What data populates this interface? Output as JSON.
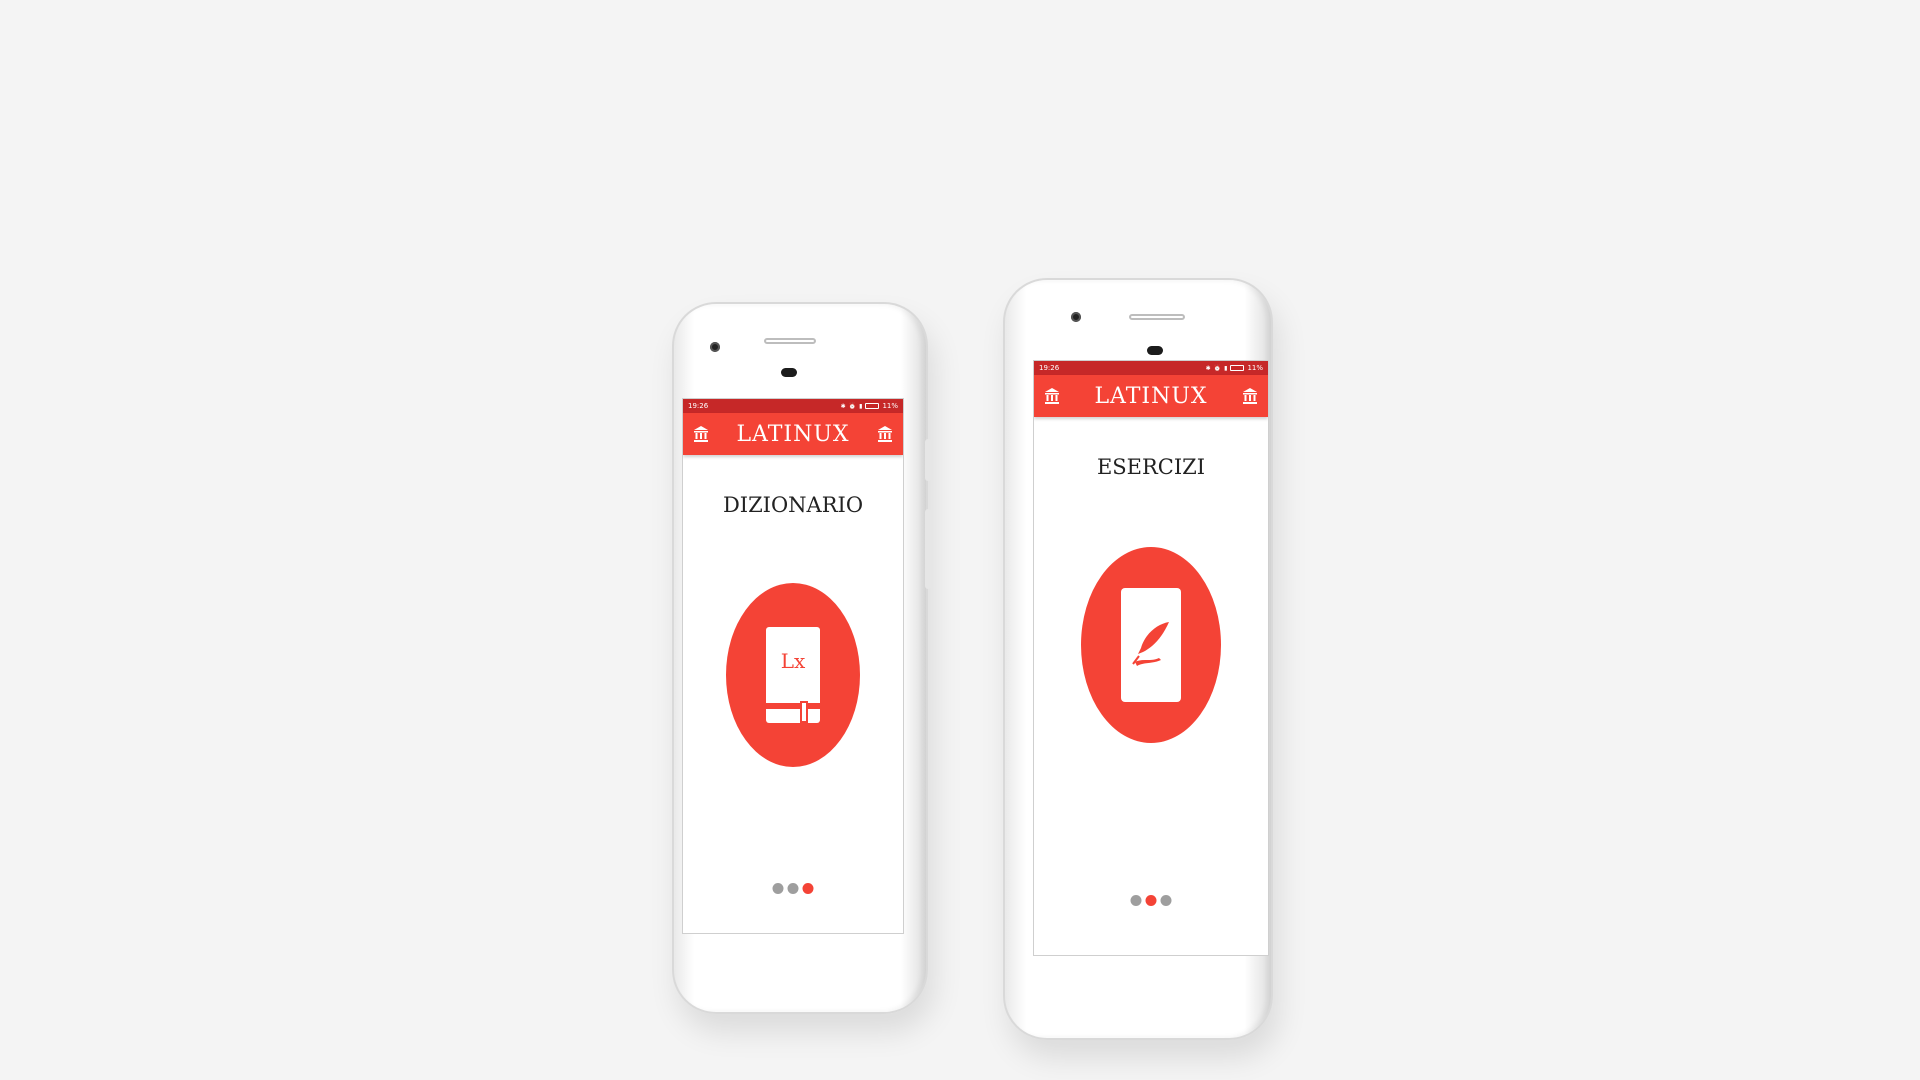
{
  "colors": {
    "primary": "#f44336",
    "status_bar": "#c62828",
    "background": "#f4f4f4",
    "inactive_dot": "#9e9e9e"
  },
  "phones": [
    {
      "status": {
        "time": "19:26",
        "battery": "11%"
      },
      "app_title": "LATINUX",
      "left_icon": "bank-icon",
      "right_icon": "bank-icon",
      "section_title": "DIZIONARIO",
      "feature_icon": "dictionary-book-icon",
      "feature_icon_text": "Lx",
      "pager": {
        "count": 3,
        "active_index": 2
      }
    },
    {
      "status": {
        "time": "19:26",
        "battery": "11%"
      },
      "app_title": "LATINUX",
      "left_icon": "bank-icon",
      "right_icon": "bank-icon",
      "section_title": "ESERCIZI",
      "feature_icon": "quill-card-icon",
      "pager": {
        "count": 3,
        "active_index": 1
      }
    }
  ]
}
